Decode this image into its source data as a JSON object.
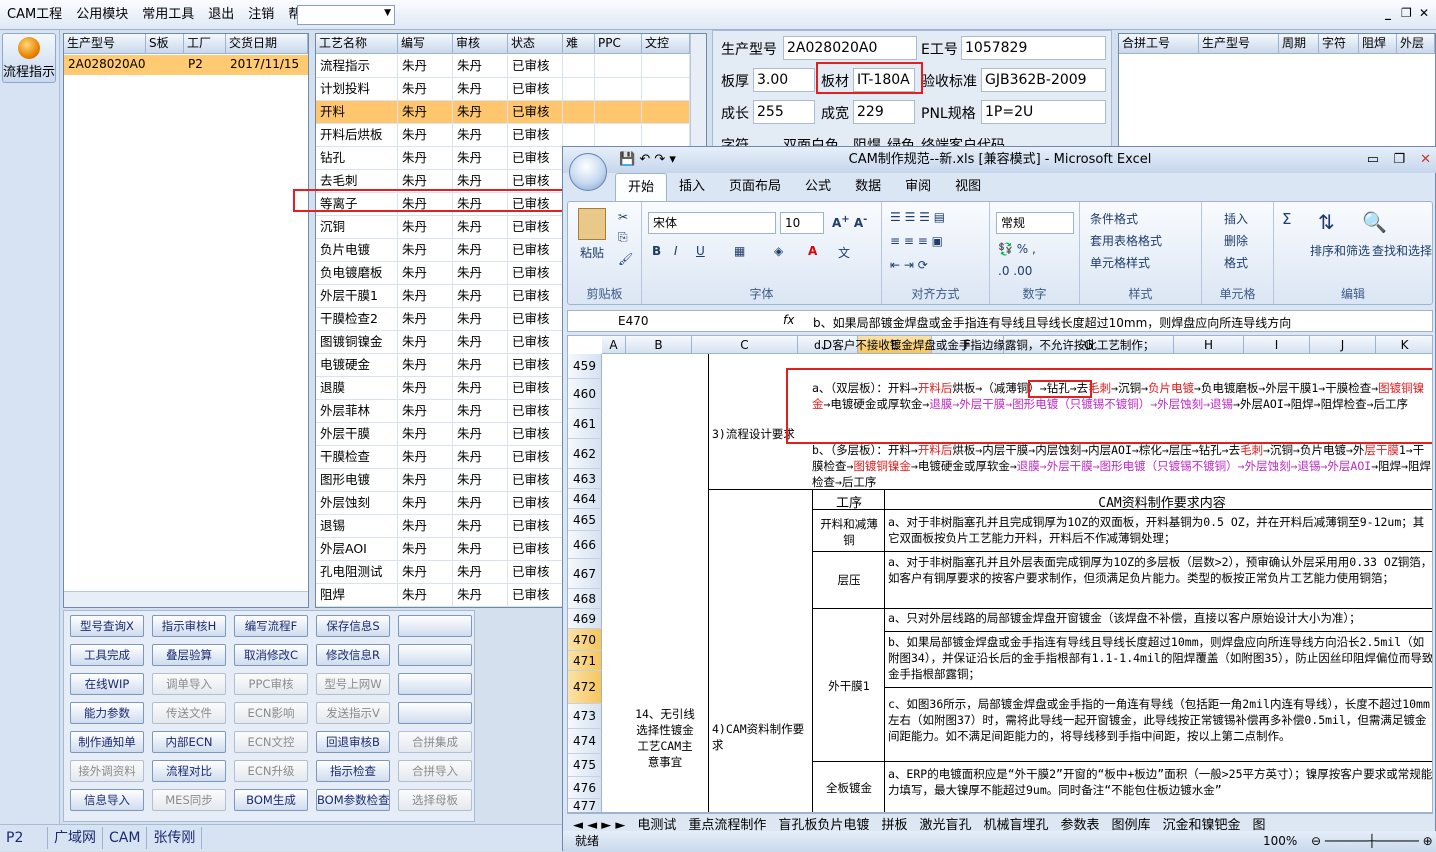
{
  "menu": {
    "items": [
      "CAM工程",
      "公用模块",
      "常用工具",
      "退出",
      "注销",
      "帮助"
    ]
  },
  "left": {
    "flow_button": "流程指示"
  },
  "products": {
    "headers": [
      "生产型号",
      "S板",
      "工厂",
      "交货日期"
    ],
    "row": [
      "2A028020A0",
      "",
      "P2",
      "2017/11/15"
    ]
  },
  "process": {
    "headers": [
      "工艺名称",
      "编写",
      "审核",
      "状态",
      "难",
      "PPC",
      "文控"
    ],
    "rows": [
      [
        "流程指示",
        "朱丹",
        "朱丹",
        "已审核"
      ],
      [
        "计划投料",
        "朱丹",
        "朱丹",
        "已审核"
      ],
      [
        "开料",
        "朱丹",
        "朱丹",
        "已审核"
      ],
      [
        "开料后烘板",
        "朱丹",
        "朱丹",
        "已审核"
      ],
      [
        "钻孔",
        "朱丹",
        "朱丹",
        "已审核"
      ],
      [
        "去毛刺",
        "朱丹",
        "朱丹",
        "已审核"
      ],
      [
        "等离子",
        "朱丹",
        "朱丹",
        "已审核"
      ],
      [
        "沉铜",
        "朱丹",
        "朱丹",
        "已审核"
      ],
      [
        "负片电镀",
        "朱丹",
        "朱丹",
        "已审核"
      ],
      [
        "负电镀磨板",
        "朱丹",
        "朱丹",
        "已审核"
      ],
      [
        "外层干膜1",
        "朱丹",
        "朱丹",
        "已审核"
      ],
      [
        "干膜检查2",
        "朱丹",
        "朱丹",
        "已审核"
      ],
      [
        "图镀铜镍金",
        "朱丹",
        "朱丹",
        "已审核"
      ],
      [
        "电镀硬金",
        "朱丹",
        "朱丹",
        "已审核"
      ],
      [
        "退膜",
        "朱丹",
        "朱丹",
        "已审核"
      ],
      [
        "外层菲林",
        "朱丹",
        "朱丹",
        "已审核"
      ],
      [
        "外层干膜",
        "朱丹",
        "朱丹",
        "已审核"
      ],
      [
        "干膜检查",
        "朱丹",
        "朱丹",
        "已审核"
      ],
      [
        "图形电镀",
        "朱丹",
        "朱丹",
        "已审核"
      ],
      [
        "外层蚀刻",
        "朱丹",
        "朱丹",
        "已审核"
      ],
      [
        "退锡",
        "朱丹",
        "朱丹",
        "已审核"
      ],
      [
        "外层AOI",
        "朱丹",
        "朱丹",
        "已审核"
      ],
      [
        "孔电阻测试",
        "朱丹",
        "朱丹",
        "已审核"
      ],
      [
        "阻焊",
        "朱丹",
        "朱丹",
        "已审核"
      ]
    ]
  },
  "buttons": [
    [
      "型号查询X",
      "指示审核H",
      "编写流程F",
      "保存信息S",
      ""
    ],
    [
      "工具完成",
      "叠层验算",
      "取消修改C",
      "修改信息R",
      ""
    ],
    [
      "在线WIP",
      "调单导入",
      "PPC审核",
      "型号上网W",
      ""
    ],
    [
      "能力参数",
      "传送文件",
      "ECN影响",
      "发送指示V",
      ""
    ],
    [
      "制作通知单",
      "内部ECN",
      "ECN文控",
      "回退审核B",
      "合拼集成"
    ],
    [
      "接外调资料",
      "流程对比",
      "ECN升级",
      "指示检查",
      "合拼导入"
    ],
    [
      "信息导入",
      "MES同步",
      "BOM生成",
      "BOM参数检查",
      "选择母板"
    ]
  ],
  "bottom": {
    "factory": "P2",
    "tabs": [
      "广域网",
      "CAM",
      "张传刚"
    ]
  },
  "info": {
    "model_label": "生产型号",
    "model": "2A028020A0",
    "eno_label": "E工号",
    "eno": "1057829",
    "thick_label": "板厚",
    "thick": "3.00",
    "mat_label": "板材",
    "mat": "IT-180A",
    "std_label": "验收标准",
    "std": "GJB362B-2009",
    "len_label": "成长",
    "len": "255",
    "wid_label": "成宽",
    "wid": "229",
    "pnl_label": "PNL规格",
    "pnl": "1P=2U",
    "r4a": "字符",
    "r4b": "双面白色",
    "r4c": "阻焊",
    "r4d": "绿色",
    "r4e": "终端客户代码"
  },
  "merge": {
    "headers": [
      "合拼工号",
      "生产型号",
      "周期",
      "字符",
      "阻焊",
      "外层"
    ]
  },
  "excel": {
    "title": "CAM制作规范--新.xls  [兼容模式] - Microsoft Excel",
    "tabs": [
      "开始",
      "插入",
      "页面布局",
      "公式",
      "数据",
      "审阅",
      "视图"
    ],
    "clipboard": {
      "paste": "粘贴",
      "label": "剪贴板"
    },
    "font": {
      "name": "宋体",
      "size": "10",
      "label": "字体"
    },
    "align": {
      "label": "对齐方式"
    },
    "number": {
      "format": "常规",
      "label": "数字"
    },
    "style": {
      "cond": "条件格式",
      "table": "套用表格格式",
      "cell": "单元格样式",
      "label": "样式"
    },
    "cells": {
      "insert": "插入",
      "delete": "删除",
      "format": "格式",
      "label": "单元格"
    },
    "edit": {
      "sort": "排序和筛选",
      "find": "查找和选择",
      "label": "编辑"
    },
    "namebox": "E470",
    "formula": "b、如果局部镀金焊盘或金手指连有导线且导线长度超过10mm，则焊盘应向所连导线方向",
    "cols": [
      "A",
      "B",
      "C",
      "D",
      "E",
      "F",
      "G",
      "H",
      "I",
      "J",
      "K"
    ],
    "rows": [
      "459",
      "460",
      "461",
      "462",
      "463",
      "464",
      "465",
      "466",
      "467",
      "468",
      "469",
      "470",
      "471",
      "472",
      "473",
      "474",
      "475",
      "476",
      "477"
    ],
    "cells_text": {
      "r459": "d、客户不接收镀金焊盘或金手指边缘露铜，不允许按此工艺制作；",
      "flow_label": "3)流程设计要求",
      "a_label": "14、无引线选择性镀金工艺CAM主意事宜",
      "cam_label": "4)CAM资料制作要求",
      "proc_hdr": "工序",
      "req_hdr": "CAM资料制作要求内容",
      "p1": "开料和减薄铜",
      "p1t": "a、对于非树脂塞孔并且完成铜厚为1OZ的双面板，开料基铜为0.5 OZ，并在开料后减薄铜至9-12um；其它双面板按负片工艺能力开料，开料后不作减薄铜处理；",
      "p2": "层压",
      "p2t": "a、对于非树脂塞孔并且外层表面完成铜厚为1OZ的多层板（层数>2），预审确认外层采用用0.33 OZ铜箔，如客户有铜厚要求的按客户要求制作，但须满足负片能力。类型的板按正常负片工艺能力使用铜箔；",
      "p3": "外干膜1",
      "p3a": "a、只对外层线路的局部镀金焊盘开窗镀金（该焊盘不补偿，直接以客户原始设计大小为准）；",
      "p3b": "b、如果局部镀金焊盘或金手指连有导线且导线长度超过10mm，则焊盘应向所连导线方向沿长2.5mil（如附图34），并保证沿长后的金手指根部有1.1-1.4mil的阻焊覆盖（如附图35），防止因丝印阻焊偏位而导致金手指根部露铜；",
      "p3c": "c、如图36所示，局部镀金焊盘或金手指的一角连有导线（包括距一角2mil内连有导线），长度不超过10mm左右（如附图37）时，需将此导线一起开窗镀金，此导线按正常镀锡补偿再多补偿0.5mil，但需满足镀金间距能力。如不满足间距能力的，将导线移到手指中间距，按以上第二点制作。",
      "p4": "全板镀金",
      "p4t": "a、ERP的电镀面积应是“外干膜2”开窗的“板中+板边”面积（一般>25平方英寸）；镍厚按客户要求或常规能力填写，最大镍厚不能超过9um。同时备注“不能包住板边镀水金”"
    },
    "sheets": [
      "电测试",
      "重点流程制作",
      "盲孔板负片电镀",
      "拼板",
      "激光盲孔",
      "机械盲埋孔",
      "参数表",
      "图例库",
      "沉金和镍钯金",
      "图"
    ],
    "status": "就绪",
    "zoom": "100%"
  }
}
